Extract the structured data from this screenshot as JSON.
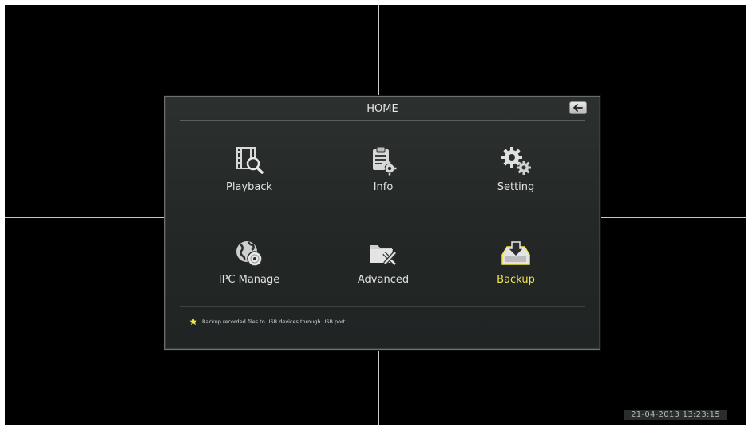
{
  "menu": {
    "title": "HOME",
    "back_icon": "back-arrow-icon",
    "items": [
      {
        "label": "Playback",
        "icon": "film-search-icon"
      },
      {
        "label": "Info",
        "icon": "clipboard-gear-icon"
      },
      {
        "label": "Setting",
        "icon": "gears-icon"
      },
      {
        "label": "IPC Manage",
        "icon": "globe-disc-icon"
      },
      {
        "label": "Advanced",
        "icon": "folder-tools-icon"
      },
      {
        "label": "Backup",
        "icon": "tray-download-icon",
        "selected": true
      }
    ],
    "tip": "Backup recorded files to USB devices through USB port."
  },
  "status": {
    "timestamp": "21-04-2013 13:23:15"
  },
  "colors": {
    "selected_label": "#f0e64a",
    "label": "#e2e2e2",
    "panel_bg": "#252928",
    "screen_bg": "#000000"
  }
}
